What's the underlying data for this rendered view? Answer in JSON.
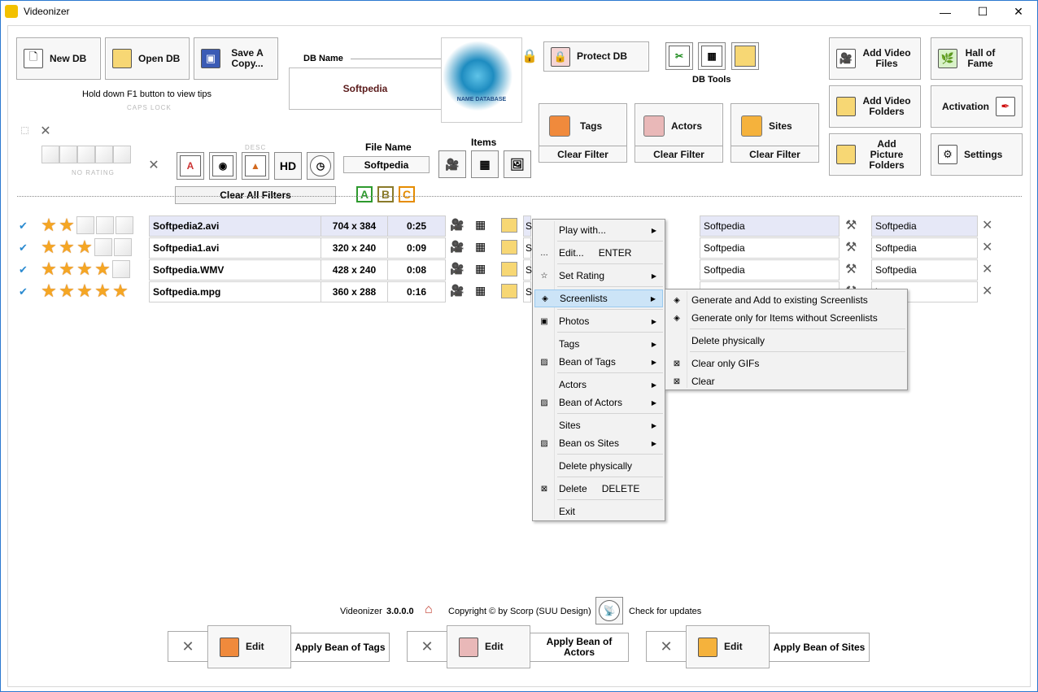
{
  "window": {
    "title": "Videonizer",
    "minimize": "—",
    "maximize": "☐",
    "close": "✕"
  },
  "toolbar": {
    "new_db": "New DB",
    "open_db": "Open DB",
    "save_copy": "Save A Copy...",
    "tip": "Hold down F1 button to view tips",
    "caps_lock": "CAPS LOCK",
    "db_name_label": "DB Name",
    "db_name_value": "Softpedia",
    "db_logo_text": "NAME DATABASE",
    "protect_db": "Protect DB",
    "db_tools": "DB Tools",
    "add_video_files": "Add Video Files",
    "hall_of_fame": "Hall of Fame",
    "add_video_folders": "Add Video Folders",
    "activation": "Activation",
    "add_picture_folders": "Add Picture Folders",
    "settings": "Settings"
  },
  "filters": {
    "no_rating": "NO RATING",
    "desc": "DESC",
    "hd": "HD",
    "file_name_label": "File Name",
    "file_name_value": "Softpedia",
    "items_label": "Items",
    "clear_all": "Clear All Filters",
    "tags": "Tags",
    "actors": "Actors",
    "sites": "Sites",
    "clear_filter": "Clear Filter",
    "abc": [
      "A",
      "B",
      "C"
    ]
  },
  "rows": [
    {
      "stars": 2,
      "name": "Softpedia2.avi",
      "res": "704 x 384",
      "dur": "0:25",
      "actor": "Softpedia",
      "site": "Softpedia",
      "tag_prefix": "S"
    },
    {
      "stars": 3,
      "name": "Softpedia1.avi",
      "res": "320 x 240",
      "dur": "0:09",
      "actor": "Softpedia",
      "site": "Softpedia",
      "tag_prefix": "S"
    },
    {
      "stars": 4,
      "name": "Softpedia.WMV",
      "res": "428 x 240",
      "dur": "0:08",
      "actor": "Softpedia",
      "site": "Softpedia",
      "tag_prefix": "S"
    },
    {
      "stars": 5,
      "name": "Softpedia.mpg",
      "res": "360 x 288",
      "dur": "0:16",
      "actor": "",
      "site": "ia",
      "tag_prefix": "S"
    }
  ],
  "context_menu": {
    "items": [
      {
        "label": "Play with...",
        "shortcut": "",
        "submenu": true
      },
      {
        "label": "Edit...",
        "shortcut": "ENTER",
        "submenu": false
      },
      {
        "label": "Set Rating",
        "shortcut": "",
        "submenu": true
      },
      {
        "label": "Screenlists",
        "shortcut": "",
        "submenu": true
      },
      {
        "label": "Photos",
        "shortcut": "",
        "submenu": true
      },
      {
        "label": "Tags",
        "shortcut": "",
        "submenu": true
      },
      {
        "label": "Bean of Tags",
        "shortcut": "",
        "submenu": true
      },
      {
        "label": "Actors",
        "shortcut": "",
        "submenu": true
      },
      {
        "label": "Bean of Actors",
        "shortcut": "",
        "submenu": true
      },
      {
        "label": "Sites",
        "shortcut": "",
        "submenu": true
      },
      {
        "label": "Bean os Sites",
        "shortcut": "",
        "submenu": true
      },
      {
        "label": "Delete physically",
        "shortcut": "",
        "submenu": false
      },
      {
        "label": "Delete",
        "shortcut": "DELETE",
        "submenu": false
      },
      {
        "label": "Exit",
        "shortcut": "",
        "submenu": false
      }
    ],
    "submenu": [
      "Generate and Add to existing Screenlists",
      "Generate only for Items without Screenlists",
      "Delete physically",
      "Clear only GIFs",
      "Clear"
    ]
  },
  "footer": {
    "app": "Videonizer",
    "version": "3.0.0.0",
    "copyright": "Copyright © by Scorp (SUU Design)",
    "updates": "Check for updates",
    "edit": "Edit",
    "apply_tags": "Apply Bean of Tags",
    "apply_actors": "Apply Bean of Actors",
    "apply_sites": "Apply Bean of Sites"
  },
  "colors": {
    "accent": "#2b79d0",
    "star": "#f5a623",
    "highlight": "#cce4f7",
    "db_name": "#5a1a1a"
  }
}
